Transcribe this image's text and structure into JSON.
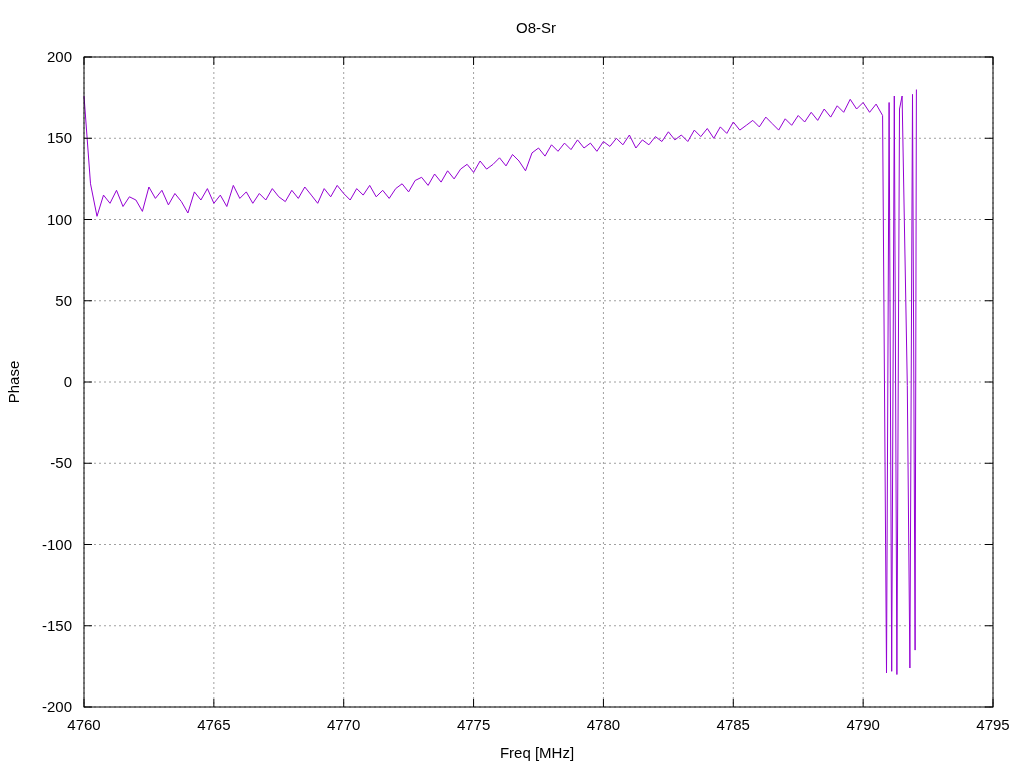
{
  "chart_data": {
    "type": "line",
    "title": "O8-Sr",
    "xlabel": "Freq [MHz]",
    "ylabel": "Phase",
    "x": [
      4760,
      4760.25,
      4760.5,
      4760.75,
      4761,
      4761.25,
      4761.5,
      4761.75,
      4762,
      4762.25,
      4762.5,
      4762.75,
      4763,
      4763.25,
      4763.5,
      4763.75,
      4764,
      4764.25,
      4764.5,
      4764.75,
      4765,
      4765.25,
      4765.5,
      4765.75,
      4766,
      4766.25,
      4766.5,
      4766.75,
      4767,
      4767.25,
      4767.5,
      4767.75,
      4768,
      4768.25,
      4768.5,
      4768.75,
      4769,
      4769.25,
      4769.5,
      4769.75,
      4770,
      4770.25,
      4770.5,
      4770.75,
      4771,
      4771.25,
      4771.5,
      4771.75,
      4772,
      4772.25,
      4772.5,
      4772.75,
      4773,
      4773.25,
      4773.5,
      4773.75,
      4774,
      4774.25,
      4774.5,
      4774.75,
      4775,
      4775.25,
      4775.5,
      4775.75,
      4776,
      4776.25,
      4776.5,
      4776.75,
      4777,
      4777.25,
      4777.5,
      4777.75,
      4778,
      4778.25,
      4778.5,
      4778.75,
      4779,
      4779.25,
      4779.5,
      4779.75,
      4780,
      4780.25,
      4780.5,
      4780.75,
      4781,
      4781.25,
      4781.5,
      4781.75,
      4782,
      4782.25,
      4782.5,
      4782.75,
      4783,
      4783.25,
      4783.5,
      4783.75,
      4784,
      4784.25,
      4784.5,
      4784.75,
      4785,
      4785.25,
      4785.5,
      4785.75,
      4786,
      4786.25,
      4786.5,
      4786.75,
      4787,
      4787.25,
      4787.5,
      4787.75,
      4788,
      4788.25,
      4788.5,
      4788.75,
      4789,
      4789.25,
      4789.5,
      4789.75,
      4790,
      4790.25,
      4790.5,
      4790.75,
      4790.9,
      4791,
      4791.1,
      4791.2,
      4791.3,
      4791.4,
      4791.5,
      4791.7,
      4791.8,
      4791.9,
      4792,
      4792.05
    ],
    "series": [
      {
        "color": "#9400d3",
        "values": [
          176,
          122,
          102,
          115,
          110,
          118,
          108,
          114,
          112,
          105,
          120,
          113,
          118,
          109,
          116,
          111,
          104,
          117,
          112,
          119,
          110,
          115,
          108,
          121,
          113,
          117,
          110,
          116,
          112,
          119,
          114,
          111,
          118,
          113,
          120,
          115,
          110,
          119,
          114,
          121,
          116,
          112,
          119,
          115,
          121,
          114,
          118,
          113,
          119,
          122,
          117,
          124,
          126,
          121,
          128,
          123,
          130,
          125,
          131,
          134,
          129,
          136,
          131,
          134,
          138,
          133,
          140,
          136,
          130,
          141,
          144,
          139,
          146,
          142,
          147,
          143,
          149,
          144,
          147,
          142,
          148,
          145,
          150,
          146,
          152,
          144,
          149,
          146,
          151,
          148,
          154,
          149,
          152,
          148,
          155,
          151,
          156,
          150,
          157,
          153,
          160,
          155,
          158,
          161,
          157,
          163,
          159,
          155,
          162,
          158,
          164,
          160,
          166,
          161,
          168,
          163,
          170,
          166,
          174,
          168,
          172,
          166,
          171,
          164,
          -179,
          172,
          -178,
          176,
          -180,
          168,
          176,
          -2,
          -176,
          177,
          -165,
          180
        ]
      }
    ],
    "xlim": [
      4760,
      4795
    ],
    "ylim": [
      -200,
      200
    ],
    "xticks": [
      4760,
      4765,
      4770,
      4775,
      4780,
      4785,
      4790,
      4795
    ],
    "yticks": [
      -200,
      -150,
      -100,
      -50,
      0,
      50,
      100,
      150,
      200
    ],
    "grid": true
  }
}
